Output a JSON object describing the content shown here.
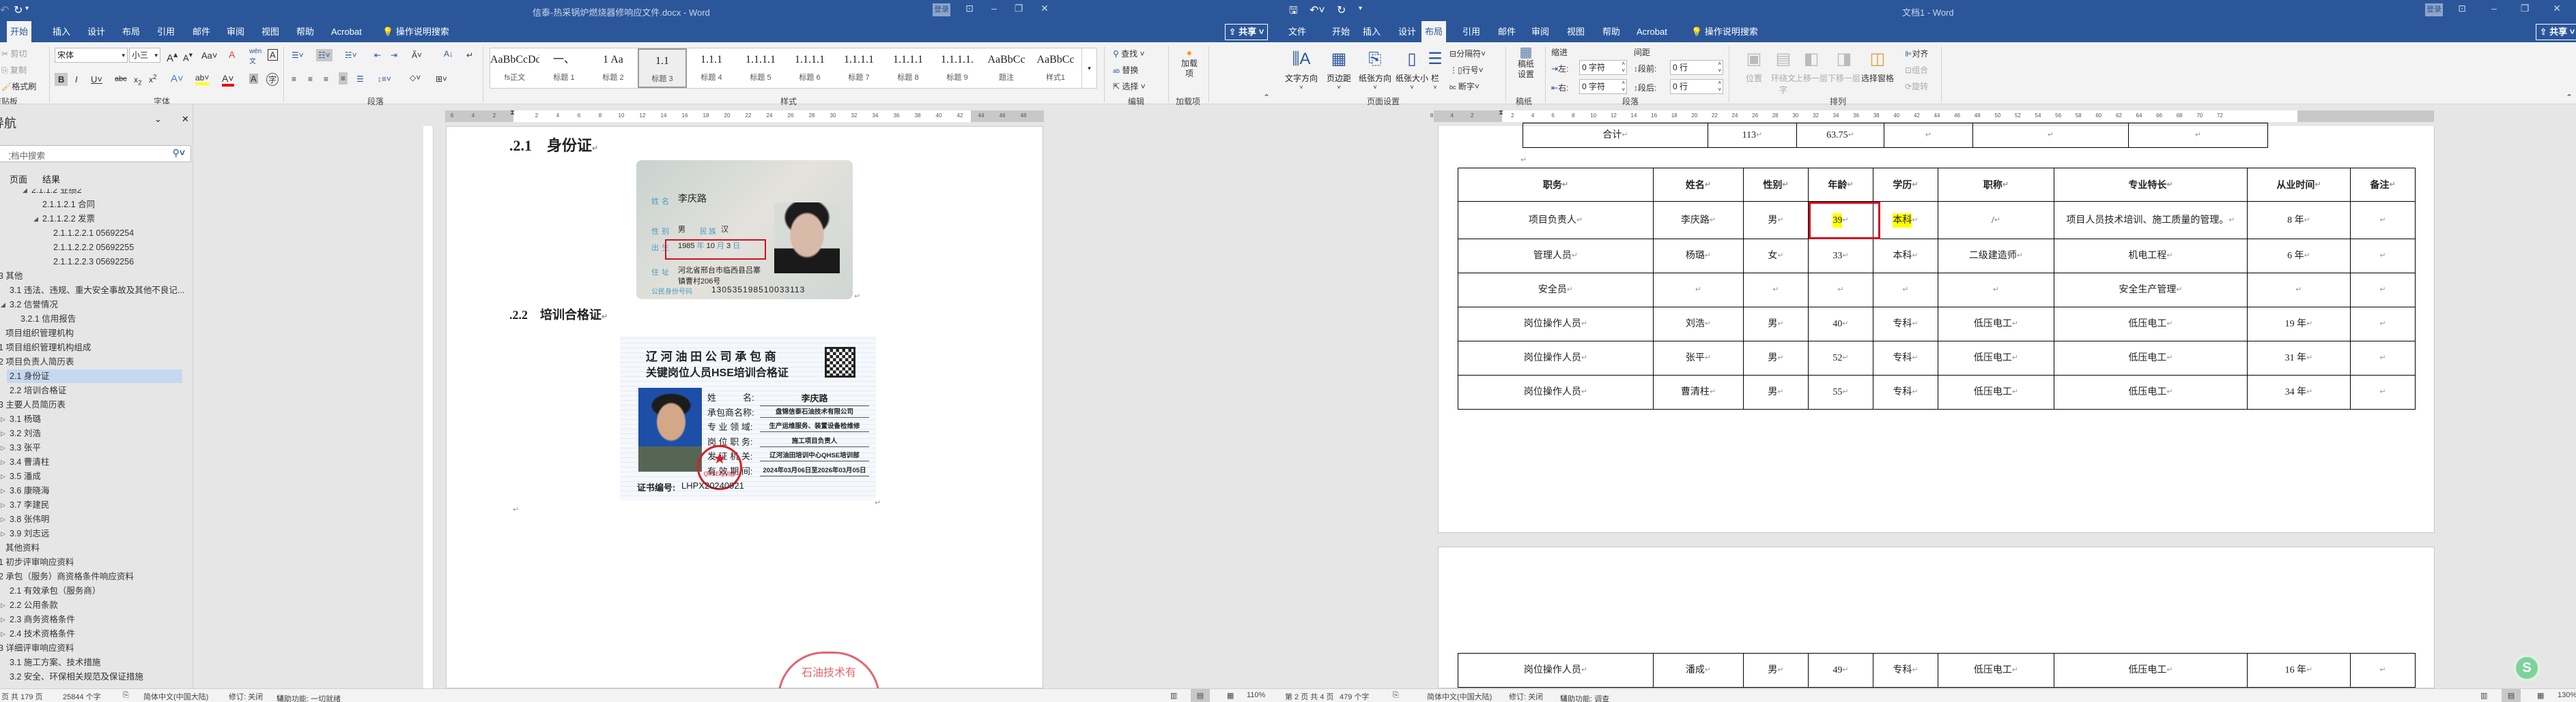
{
  "left_window": {
    "title": "信泰-热采锅炉燃烧器修响应文件.docx - Word",
    "login": "登录",
    "share": "共享",
    "tabs": [
      "开始",
      "插入",
      "设计",
      "布局",
      "引用",
      "邮件",
      "审阅",
      "视图",
      "帮助",
      "Acrobat"
    ],
    "tell_me": "操作说明搜索",
    "ribbon": {
      "clipboard": {
        "cut": "剪切",
        "copy": "复制",
        "format_painter": "格式刷",
        "label": "剪贴板"
      },
      "font": {
        "name": "宋体",
        "size": "小三",
        "label": "字体"
      },
      "paragraph": {
        "label": "段落"
      },
      "styles": {
        "label": "样式",
        "items": [
          {
            "preview": "AaBbCcDdI",
            "label": "fs正文"
          },
          {
            "preview": "一、",
            "label": "标题 1"
          },
          {
            "preview": "1  Aa",
            "label": "标题 2"
          },
          {
            "preview": "1.1",
            "label": "标题 3",
            "selected": true
          },
          {
            "preview": "1.1.1",
            "label": "标题 4"
          },
          {
            "preview": "1.1.1.1",
            "label": "标题 5"
          },
          {
            "preview": "1.1.1.1",
            "label": "标题 6"
          },
          {
            "preview": "1.1.1.1",
            "label": "标题 7"
          },
          {
            "preview": "1.1.1.1",
            "label": "标题 8"
          },
          {
            "preview": "1.1.1.1.",
            "label": "标题 9"
          },
          {
            "preview": "AaBbCc",
            "label": "题注"
          },
          {
            "preview": "AaBbCc",
            "label": "样式1"
          }
        ]
      },
      "editing": {
        "find": "查找",
        "replace": "替换",
        "select": "选择",
        "label": "编辑"
      },
      "addins": {
        "button": "加载项",
        "label": "加载项"
      }
    },
    "nav": {
      "title": "导航",
      "search_placeholder": "在文档中搜索",
      "tabs": [
        "页面",
        "结果"
      ],
      "items": [
        {
          "text": "2.1.1.2 业绩2",
          "level": 3,
          "exp": "open"
        },
        {
          "text": "2.1.1.2.1 合同",
          "level": 4
        },
        {
          "text": "2.1.1.2.2 发票",
          "level": 4,
          "exp": "open"
        },
        {
          "text": "2.1.1.2.2.1 05692254",
          "level": 5
        },
        {
          "text": "2.1.1.2.2.2 05692255",
          "level": 5
        },
        {
          "text": "2.1.1.2.2.3 05692256",
          "level": 5
        },
        {
          "text": "3 其他",
          "level": 0
        },
        {
          "text": "3.1 违法、违规、重大安全事故及其他不良记...",
          "level": 1
        },
        {
          "text": "3.2 信誉情况",
          "level": 1,
          "exp": "open"
        },
        {
          "text": "3.2.1 信用报告",
          "level": 2
        },
        {
          "text": "项目组织管理机构",
          "level": 0.5
        },
        {
          "text": "1 项目组织管理机构组成",
          "level": 0
        },
        {
          "text": "2 项目负责人简历表",
          "level": 0
        },
        {
          "text": "2.1 身份证",
          "level": 1,
          "selected": true
        },
        {
          "text": "2.2 培训合格证",
          "level": 1
        },
        {
          "text": "3 主要人员简历表",
          "level": 0
        },
        {
          "text": "3.1 杨璐",
          "level": 1,
          "exp": "closed"
        },
        {
          "text": "3.2 刘浩",
          "level": 1,
          "exp": "closed"
        },
        {
          "text": "3.3 张平",
          "level": 1,
          "exp": "closed"
        },
        {
          "text": "3.4 曹清柱",
          "level": 1,
          "exp": "closed"
        },
        {
          "text": "3.5 潘成",
          "level": 1,
          "exp": "closed"
        },
        {
          "text": "3.6 康晓海",
          "level": 1,
          "exp": "closed"
        },
        {
          "text": "3.7 李建民",
          "level": 1,
          "exp": "closed"
        },
        {
          "text": "3.8 张伟明",
          "level": 1,
          "exp": "closed"
        },
        {
          "text": "3.9 刘志远",
          "level": 1,
          "exp": "closed"
        },
        {
          "text": "其他资料",
          "level": 0.5
        },
        {
          "text": "1 初步评审响应资料",
          "level": 0
        },
        {
          "text": "2 承包（服务）商资格条件响应资料",
          "level": 0
        },
        {
          "text": "2.1 有效承包（服务商）",
          "level": 1
        },
        {
          "text": "2.2 公用条款",
          "level": 1,
          "exp": "closed"
        },
        {
          "text": "2.3 商务资格条件",
          "level": 1,
          "exp": "closed"
        },
        {
          "text": "2.4 技术资格条件",
          "level": 1,
          "exp": "closed"
        },
        {
          "text": "3 详细评审响应资料",
          "level": 0
        },
        {
          "text": "3.1 施工方案、技术措施",
          "level": 1
        },
        {
          "text": "3.2 安全、环保相关规范及保证措施",
          "level": 1
        }
      ]
    },
    "document": {
      "heading1": ".2.1    身份证",
      "heading2": ".2.2    培训合格证",
      "id_card": {
        "name_label": "姓名",
        "name": "李庆路",
        "gender_label": "性别",
        "gender": "男",
        "ethnicity_label": "民族",
        "ethnicity": "汉",
        "birth_label": "出生",
        "birth_year": "1985",
        "year_unit": "年",
        "birth_month": "10",
        "month_unit": "月",
        "birth_day": "3",
        "day_unit": "日",
        "address_label": "住址",
        "address_line1": "河北省邢台市临西县吕寨",
        "address_line2": "镇曹村206号",
        "id_label": "公民身份号码",
        "id_number": "130535198510033113"
      },
      "certificate": {
        "title1": "辽 河 油 田 公 司 承 包 商",
        "title2": "关键岗位人员HSE培训合格证",
        "fields": [
          {
            "label": "姓　　　名:",
            "value": "李庆路"
          },
          {
            "label": "承包商名称:",
            "value": "盘锦信泰石油技术有限公司"
          },
          {
            "label": "专 业 领 域:",
            "value": "生产运维服务、装置设备检维修"
          },
          {
            "label": "岗 位 职 务:",
            "value": "施工项目负责人"
          },
          {
            "label": "发 证 机 关:",
            "value": "辽河油田培训中心QHSE培训部"
          },
          {
            "label": "有 效 期 间:",
            "value": "2024年03月06日至2026年03月05日"
          }
        ],
        "cert_no_label": "证书编号:",
        "cert_no": "LHPX20240921",
        "seal_text": "QHSE培训部"
      },
      "page_seal_text": "石油技术有"
    },
    "status": {
      "page": "页  共 179 页",
      "words": "25844 个字",
      "language": "简体中文(中国大陆)",
      "track": "修订: 关闭",
      "accessibility": "辅助功能: 一切就绪",
      "zoom": "110%"
    }
  },
  "right_window": {
    "title": "文档1 - Word",
    "login": "登录",
    "share": "共享",
    "tabs": [
      "文件",
      "开始",
      "插入",
      "设计",
      "布局",
      "引用",
      "邮件",
      "审阅",
      "视图",
      "帮助",
      "Acrobat"
    ],
    "active_tab": "布局",
    "tell_me": "操作说明搜索",
    "ribbon": {
      "page_setup": {
        "text_direction": "文字方向",
        "margins": "页边距",
        "orientation": "纸张方向",
        "size": "纸张大小",
        "columns": "栏",
        "breaks": "分隔符",
        "line_numbers": "行号",
        "hyphenation": "断字",
        "label": "页面设置"
      },
      "manuscript": {
        "button_line1": "稿纸",
        "button_line2": "设置",
        "label": "稿纸"
      },
      "paragraph": {
        "indent_title": "缩进",
        "spacing_title": "间距",
        "left_label": "左:",
        "left_value": "0 字符",
        "right_label": "右:",
        "right_value": "0 字符",
        "before_label": "段前:",
        "before_value": "0 行",
        "after_label": "段后:",
        "after_value": "0 行",
        "label": "段落"
      },
      "arrange": {
        "position": "位置",
        "wrap_line1": "环绕文",
        "wrap_line2": "字",
        "forward": "上移一层",
        "backward": "下移一层",
        "selection_pane": "选择窗格",
        "align": "对齐",
        "group": "组合",
        "rotate": "旋转",
        "label": "排列"
      }
    },
    "prev_table_row": [
      "合计",
      "113",
      "63.75",
      "",
      "",
      ""
    ],
    "table": {
      "headers": [
        "职务",
        "姓名",
        "性别",
        "年龄",
        "学历",
        "职称",
        "专业特长",
        "从业时间",
        "备注"
      ],
      "rows": [
        [
          "项目负责人",
          "李庆路",
          "男",
          "39",
          "本科",
          "/",
          "项目人员技术培训、施工质量的管理。",
          "8 年",
          ""
        ],
        [
          "管理人员",
          "杨璐",
          "女",
          "33",
          "本科",
          "二级建造师",
          "机电工程",
          "6 年",
          ""
        ],
        [
          "安全员",
          "",
          "",
          "",
          "",
          "",
          "安全生产管理",
          "",
          ""
        ],
        [
          "岗位操作人员",
          "刘浩",
          "男",
          "40",
          "专科",
          "低压电工",
          "低压电工",
          "19 年",
          ""
        ],
        [
          "岗位操作人员",
          "张平",
          "男",
          "52",
          "专科",
          "低压电工",
          "低压电工",
          "31 年",
          ""
        ],
        [
          "岗位操作人员",
          "曹清柱",
          "男",
          "55",
          "专科",
          "低压电工",
          "低压电工",
          "34 年",
          ""
        ]
      ],
      "page2_rows": [
        [
          "岗位操作人员",
          "潘成",
          "男",
          "49",
          "专科",
          "低压电工",
          "低压电工",
          "16 年",
          ""
        ]
      ],
      "highlighted_cells": [
        [
          0,
          3
        ],
        [
          0,
          4
        ]
      ],
      "boxed_cell": [
        0,
        3
      ]
    },
    "status": {
      "page": "第 2 页  共 4 页",
      "words": "479 个字",
      "language": "简体中文(中国大陆)",
      "track": "修订: 关闭",
      "accessibility": "辅助功能: 调查",
      "zoom": "130%"
    }
  },
  "colors": {
    "brand": "#2b579a",
    "highlight": "#ffff00",
    "annotation_box": "#d0101e",
    "nav_selected": "#c5d8f1"
  }
}
